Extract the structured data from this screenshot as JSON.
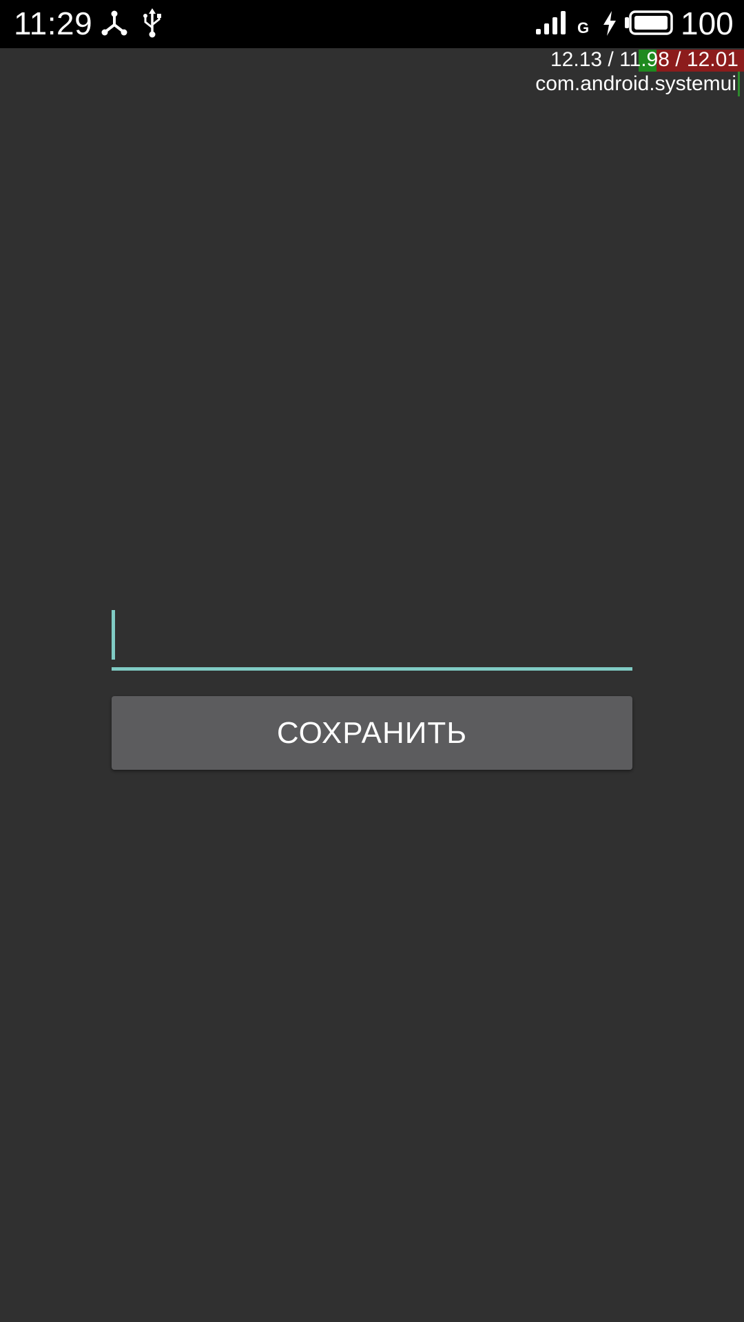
{
  "status_bar": {
    "time": "11:29",
    "network_type": "G",
    "battery_level": "100",
    "icons": [
      "usb-debug-icon",
      "usb-icon",
      "signal-icon",
      "charging-icon",
      "battery-icon"
    ]
  },
  "overlay": {
    "load_average": "12.13 / 11.98 / 12.01",
    "process": "com.android.systemui"
  },
  "form": {
    "input_value": "",
    "accent_color": "#80cbc4",
    "save_label": "СОХРАНИТЬ"
  },
  "colors": {
    "background": "#303030",
    "button": "#5c5c5e",
    "status_bar": "#000000"
  }
}
